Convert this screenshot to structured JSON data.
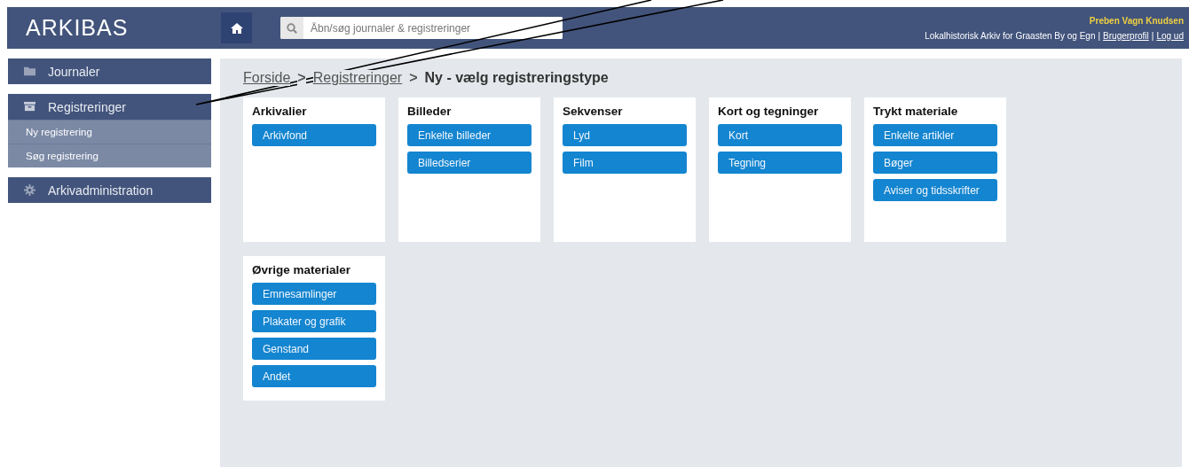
{
  "header": {
    "logo": "ARKIBAS",
    "search": {
      "placeholder": "Åbn/søg journaler & registreringer"
    },
    "user": "Preben Vagn Knudsen",
    "archive": "Lokalhistorisk Arkiv for Graasten By og Egn",
    "separator": "|",
    "links": [
      "Brugerprofil",
      "Log ud"
    ]
  },
  "sidebar": {
    "items": [
      {
        "label": "Journaler"
      },
      {
        "label": "Registreringer",
        "children": [
          {
            "label": "Ny registrering"
          },
          {
            "label": "Søg registrering"
          }
        ]
      },
      {
        "label": "Arkivadministration"
      }
    ]
  },
  "breadcrumb": {
    "links": [
      "Forside",
      "Registreringer"
    ],
    "separator": ">",
    "current": "Ny - vælg registreringstype"
  },
  "cards": [
    {
      "title": "Arkivalier",
      "buttons": [
        "Arkivfond"
      ]
    },
    {
      "title": "Billeder",
      "buttons": [
        "Enkelte billeder",
        "Billedserier"
      ]
    },
    {
      "title": "Sekvenser",
      "buttons": [
        "Lyd",
        "Film"
      ]
    },
    {
      "title": "Kort og tegninger",
      "buttons": [
        "Kort",
        "Tegning"
      ]
    },
    {
      "title": "Trykt materiale",
      "buttons": [
        "Enkelte artikler",
        "Bøger",
        "Aviser og tidsskrifter"
      ]
    },
    {
      "title": "Øvrige materialer",
      "buttons": [
        "Emnesamlinger",
        "Plakater og grafik",
        "Genstand",
        "Andet"
      ]
    }
  ]
}
